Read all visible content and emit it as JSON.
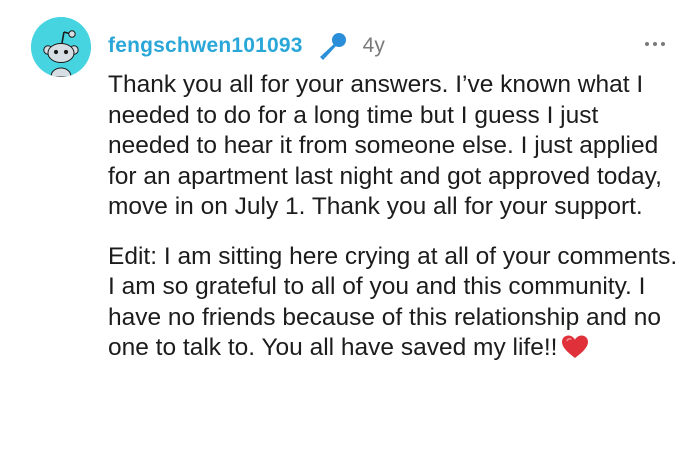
{
  "comment": {
    "author": "fengschwen101093",
    "author_badge_icon": "microphone-icon",
    "timestamp": "4y",
    "more_options_icon": "more-options-icon",
    "paragraphs": [
      "Thank you all for your answers. I’ve known what I needed to do for a long time but I guess I just needed to hear it from someone else. I just applied for an apartment last night and got approved today, move in on July 1. Thank you all for your support.",
      "Edit: I am sitting here crying at all of your comments. I am so grateful to all of you and this community. I have no friends because of this relationship and no one to talk to. You all have saved my life!!"
    ],
    "trailing_emoji": "heart-icon"
  },
  "colors": {
    "username": "#2aa7d8",
    "avatar_background": "#46d4e0",
    "badge": "#2a8fd8",
    "heart": "#e0303a",
    "muted_text": "#7a7a7a",
    "body_text": "#1c1c1c"
  }
}
